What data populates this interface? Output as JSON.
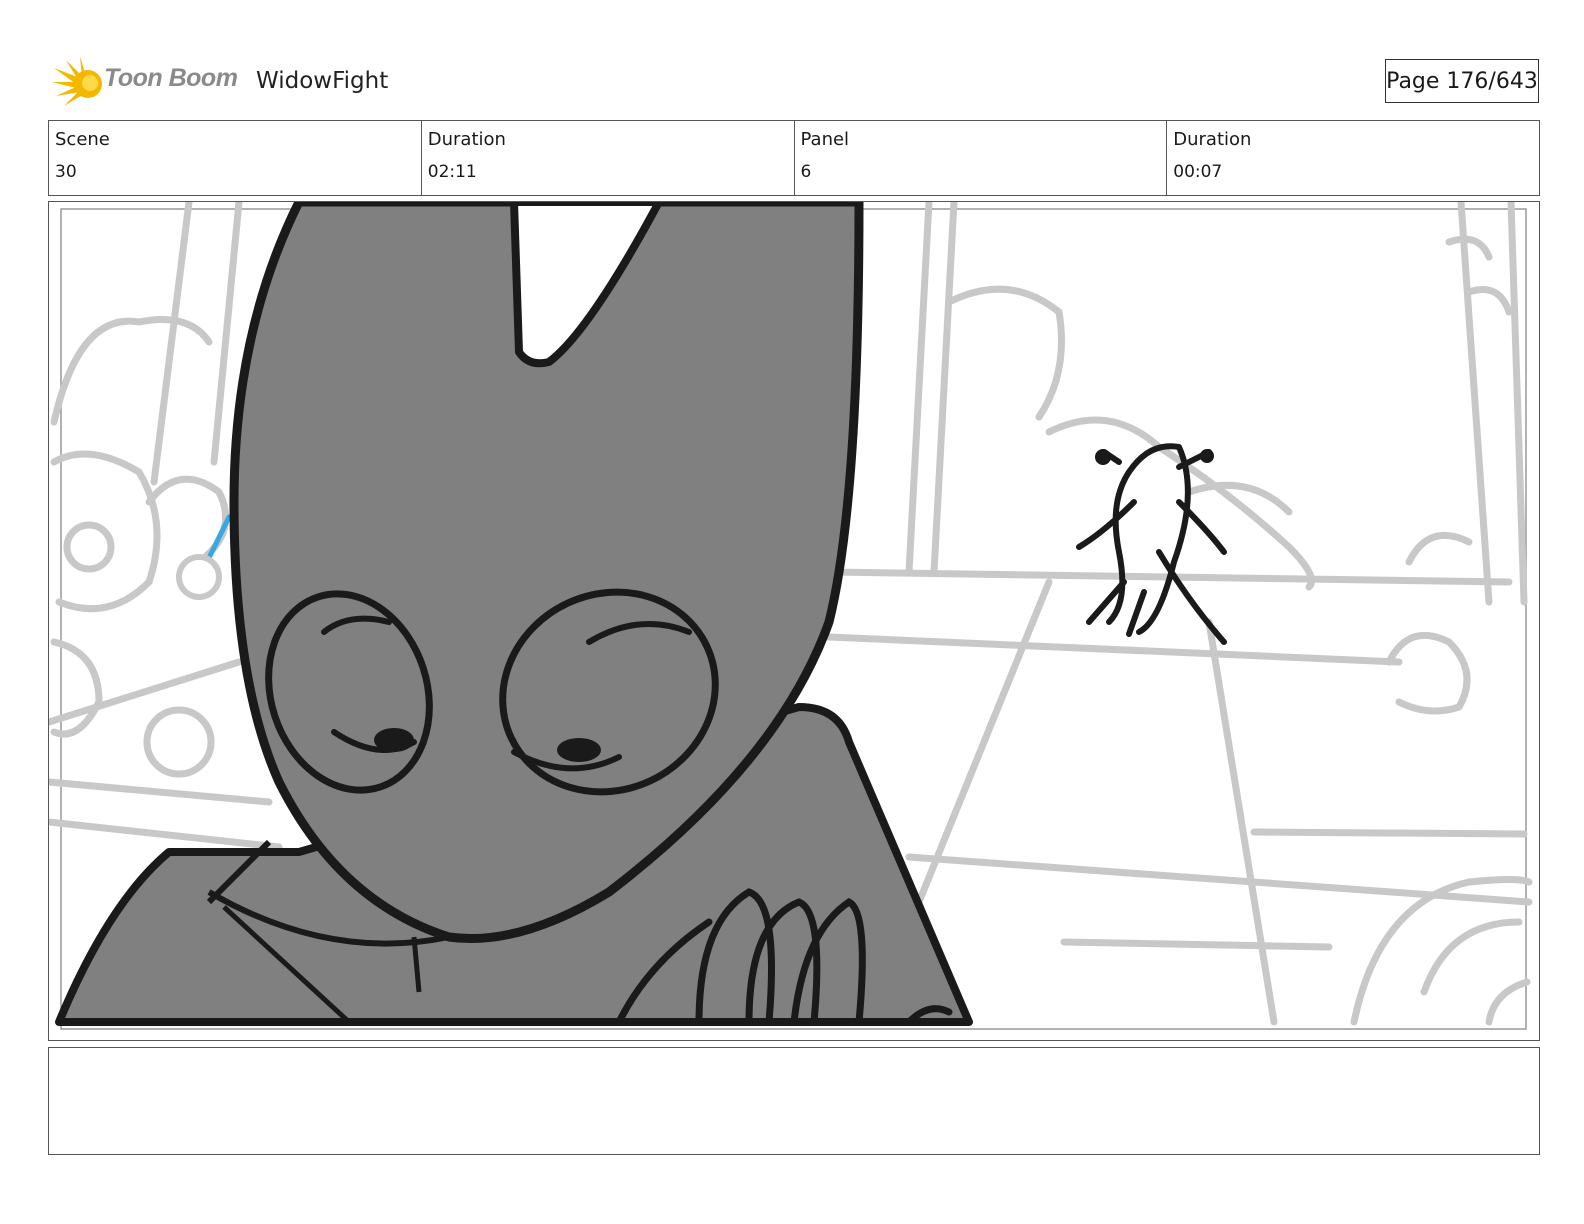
{
  "header": {
    "brand": "Toon Boom",
    "project_title": "WidowFight",
    "page_label": "Page 176/643"
  },
  "info": [
    {
      "label": "Scene",
      "value": "30"
    },
    {
      "label": "Duration",
      "value": "02:11"
    },
    {
      "label": "Panel",
      "value": "6"
    },
    {
      "label": "Duration",
      "value": "00:07"
    }
  ],
  "colors": {
    "logo_flame": "#f5b800",
    "logo_core": "#ffd94a",
    "character_fill": "#808080",
    "outline": "#1a1a1a",
    "background_lines": "#c8c8c8",
    "accent_line": "#3aa8e0"
  },
  "icons": {
    "logo": "toon-boom-burst-icon"
  }
}
